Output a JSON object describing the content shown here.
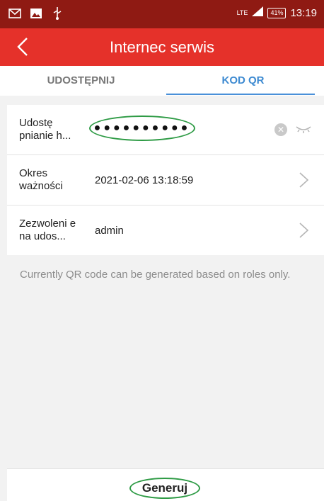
{
  "status_bar": {
    "left_icons": [
      "mail-icon",
      "image-icon",
      "usb-icon"
    ],
    "network": "LTE",
    "battery": "41%",
    "time": "13:19"
  },
  "app_bar": {
    "back_icon": "chevron-left-icon",
    "title": "Internec serwis"
  },
  "tabs": [
    {
      "label": "UDOSTĘPNIJ",
      "active": false
    },
    {
      "label": "KOD QR",
      "active": true
    }
  ],
  "form": {
    "rows": [
      {
        "label": "Udostę pnianie h...",
        "value": "●●●●●●●●●●",
        "type": "password"
      },
      {
        "label": "Okres ważności",
        "value": "2021-02-06 13:18:59",
        "type": "select"
      },
      {
        "label": "Zezwoleni e na udos...",
        "value": "admin",
        "type": "select"
      }
    ]
  },
  "info_text": "Currently QR code can be generated based on roles only.",
  "generate_button": "Generuj",
  "colors": {
    "status_bar": "#8f1a13",
    "app_bar": "#e5312a",
    "active_tab": "#3d8ad1",
    "highlight": "#2e9b45"
  }
}
